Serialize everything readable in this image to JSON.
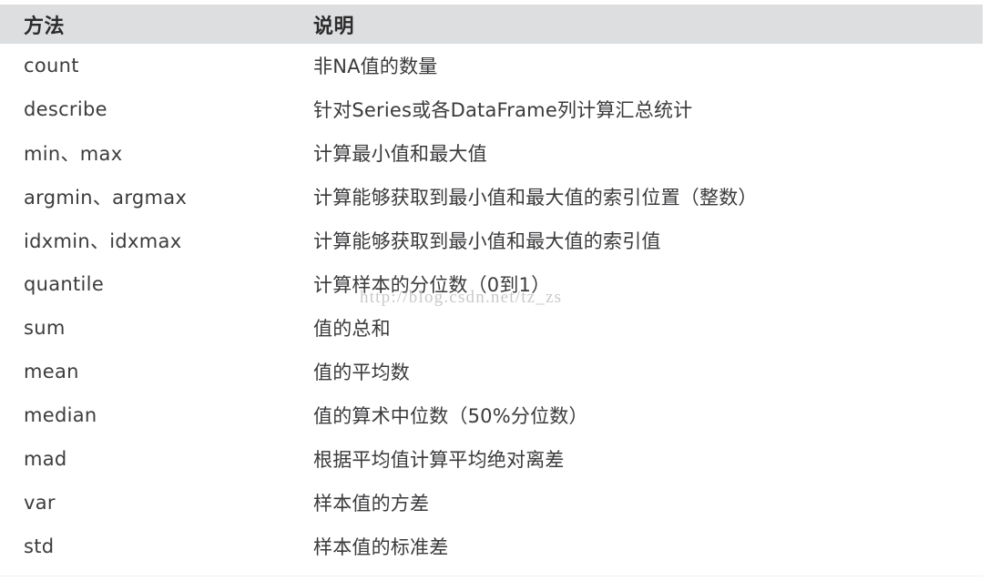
{
  "table": {
    "columns": [
      {
        "key": "method",
        "label": "方法"
      },
      {
        "key": "description",
        "label": "说明"
      }
    ],
    "rows": [
      {
        "method": "count",
        "description": "非NA值的数量"
      },
      {
        "method": "describe",
        "description": "针对Series或各DataFrame列计算汇总统计"
      },
      {
        "method": "min、max",
        "description": "计算最小值和最大值"
      },
      {
        "method": "argmin、argmax",
        "description": "计算能够获取到最小值和最大值的索引位置（整数）"
      },
      {
        "method": "idxmin、idxmax",
        "description": "计算能够获取到最小值和最大值的索引值"
      },
      {
        "method": "quantile",
        "description": "计算样本的分位数（0到1）"
      },
      {
        "method": "sum",
        "description": "值的总和"
      },
      {
        "method": "mean",
        "description": "值的平均数"
      },
      {
        "method": "median",
        "description": "值的算术中位数（50%分位数）"
      },
      {
        "method": "mad",
        "description": "根据平均值计算平均绝对离差"
      },
      {
        "method": "var",
        "description": "样本值的方差"
      },
      {
        "method": "std",
        "description": "样本值的标准差"
      }
    ]
  },
  "watermark": {
    "text": "http://blog.csdn.net/tz_zs"
  },
  "colors": {
    "header_background": "#dddee0",
    "body_background": "#ffffff",
    "header_text": "#2b2b2b",
    "body_text": "#3a3a3c",
    "watermark_text": "#c9c9cb"
  }
}
